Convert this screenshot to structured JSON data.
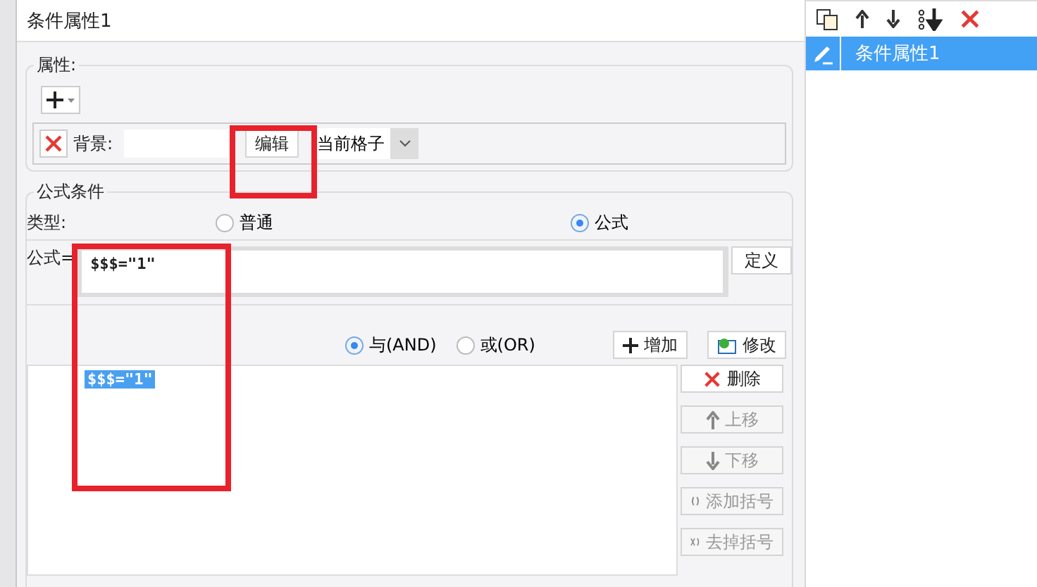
{
  "dialog": {
    "title": "条件属性1",
    "properties": {
      "legend": "属性:",
      "rows": [
        {
          "label": "背景:",
          "edit_button": "编辑",
          "scope": "当前格子"
        }
      ]
    },
    "formula_condition": {
      "legend": "公式条件",
      "type_label": "类型:",
      "types": [
        {
          "label": "普通",
          "selected": false
        },
        {
          "label": "公式",
          "selected": true
        }
      ],
      "formula_label": "公式=",
      "formula": "$$$=\"1\"",
      "define_button": "定义",
      "joins": [
        {
          "label": "与(AND)",
          "selected": true
        },
        {
          "label": "或(OR)",
          "selected": false
        }
      ],
      "add_button": "增加",
      "modify_button": "修改",
      "conditions": [
        {
          "text": "$$$=\"1\"",
          "selected": true
        }
      ],
      "actions": [
        {
          "kind": "delete",
          "label": "删除",
          "disabled": false
        },
        {
          "kind": "up",
          "label": "上移",
          "disabled": true
        },
        {
          "kind": "down",
          "label": "下移",
          "disabled": true
        },
        {
          "kind": "add-brackets",
          "label": "添加括号",
          "disabled": true
        },
        {
          "kind": "remove-brackets",
          "label": "去掉括号",
          "disabled": true
        }
      ]
    }
  },
  "side_panel": {
    "items": [
      {
        "label": "条件属性1",
        "selected": true
      }
    ]
  }
}
